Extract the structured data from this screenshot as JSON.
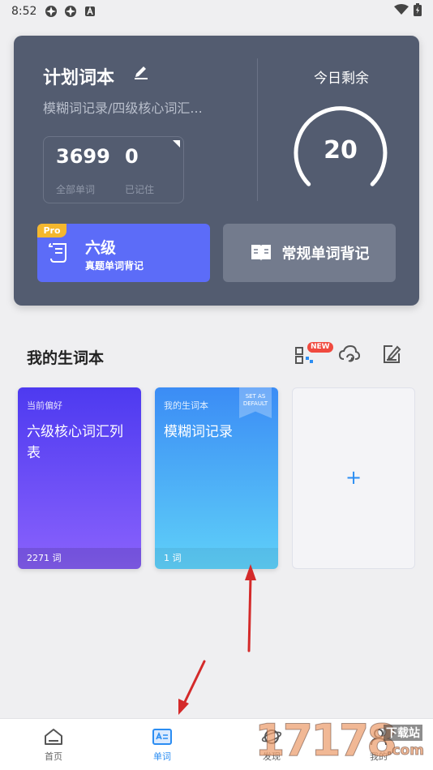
{
  "status_bar": {
    "time": "8:52"
  },
  "plan": {
    "title": "计划词本",
    "subtitle": "模糊词记录/四级核心词汇...",
    "total_words": "3699",
    "total_words_label": "全部单词",
    "remembered": "0",
    "remembered_label": "已记住",
    "today_remaining_label": "今日剩余",
    "today_remaining": "20",
    "cet_button": {
      "badge": "Pro",
      "title": "六级",
      "subtitle": "真题单词背记"
    },
    "regular_button_label": "常规单词背记"
  },
  "wordbooks": {
    "section_title": "我的生词本",
    "new_badge": "NEW",
    "cards": [
      {
        "tag": "当前偏好",
        "name": "六级核心词汇列表",
        "count": "2271 词"
      },
      {
        "tag": "我的生词本",
        "name": "模糊词记录",
        "count": "1 词",
        "ribbon_line1": "SET AS",
        "ribbon_line2": "DEFAULT"
      }
    ],
    "add_label": "+"
  },
  "tabs": [
    {
      "label": "首页"
    },
    {
      "label": "单词"
    },
    {
      "label": "发现"
    },
    {
      "label": "我的"
    }
  ],
  "watermark": {
    "digits": "17178",
    "chinese": "下载站",
    "com": ".com"
  },
  "colors": {
    "accent": "#2b8df2",
    "card_bg": "#535c70",
    "cet_blue": "#5c6cf8",
    "pro_badge": "#f4b72e",
    "new_badge": "#f04a3f",
    "arrow": "#d42a2a"
  }
}
